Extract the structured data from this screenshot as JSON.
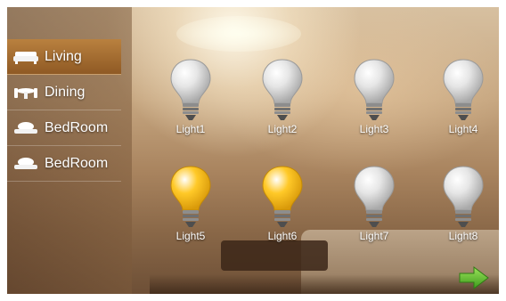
{
  "sidebar": {
    "items": [
      {
        "label": "Living",
        "icon": "sofa-icon",
        "active": true
      },
      {
        "label": "Dining",
        "icon": "dining-table-icon",
        "active": false
      },
      {
        "label": "BedRoom",
        "icon": "bed-icon",
        "active": false
      },
      {
        "label": "BedRoom",
        "icon": "bed-icon",
        "active": false
      }
    ]
  },
  "lights": [
    {
      "label": "Light1",
      "state": "off"
    },
    {
      "label": "Light2",
      "state": "off"
    },
    {
      "label": "Light3",
      "state": "off"
    },
    {
      "label": "Light4",
      "state": "off"
    },
    {
      "label": "Light5",
      "state": "on"
    },
    {
      "label": "Light6",
      "state": "on"
    },
    {
      "label": "Light7",
      "state": "off"
    },
    {
      "label": "Light8",
      "state": "off"
    }
  ],
  "colors": {
    "active_tab": "#a86e30",
    "bulb_on": "#ffc928",
    "bulb_off": "#e6e6e6",
    "next_arrow": "#5fbf2e"
  },
  "next": {
    "icon": "arrow-right-icon"
  }
}
